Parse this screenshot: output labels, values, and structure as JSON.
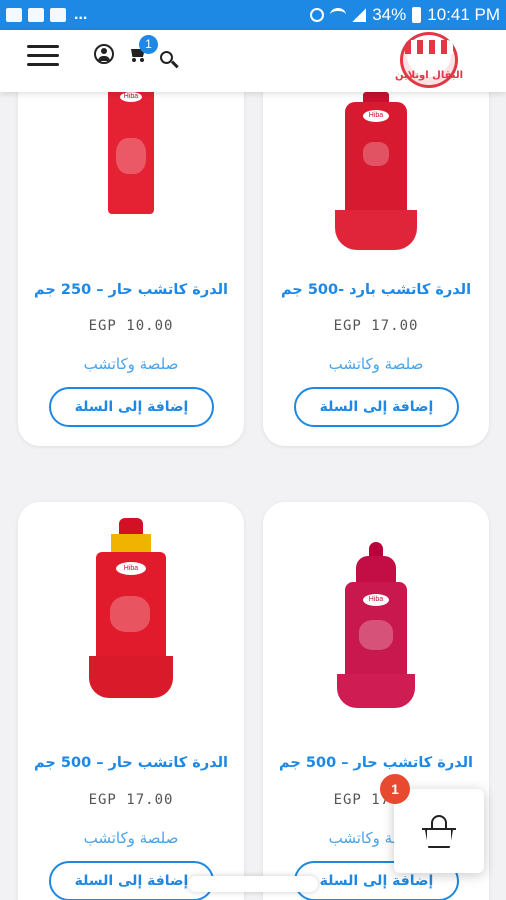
{
  "status_bar": {
    "dots": "...",
    "battery": "34%",
    "time": "10:41 PM"
  },
  "header": {
    "cart_count": "1",
    "logo_text": "البقال اونلاين"
  },
  "products": [
    {
      "name": "الدرة كاتشب بارد -500 جم",
      "price": "EGP 17.00",
      "category": "صلصة وكاتشب",
      "button": "إضافة إلى السلة"
    },
    {
      "name": "الدرة كاتشب حار – 250 جم",
      "price": "EGP 10.00",
      "category": "صلصة وكاتشب",
      "button": "إضافة إلى السلة"
    },
    {
      "name": "الدرة كاتشب حار – 500 جم",
      "price": "EGP 17.00",
      "category": "صلصة وكاتشب",
      "button": "إضافة إلى السلة"
    },
    {
      "name": "الدرة كاتشب حار – 500 جم",
      "price": "EGP 17.00",
      "category": "صلصة وكاتشب",
      "button": "إضافة إلى السلة"
    }
  ],
  "floating_cart": {
    "count": "1"
  },
  "colors": {
    "accent": "#1e88e5",
    "badge": "#e84a2f",
    "brand_red": "#e23744"
  }
}
